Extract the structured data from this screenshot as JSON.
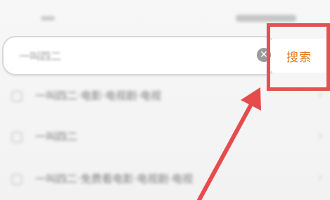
{
  "status_bar": {
    "time": "",
    "icons": [
      "signal-icon",
      "wifi-icon",
      "battery-icon"
    ]
  },
  "search": {
    "value": "一叫四二",
    "placeholder": "",
    "clear_icon": "✕",
    "button_label": "搜索"
  },
  "suggestions": [
    {
      "text": "一叫四二·电影·电视剧·电视",
      "icon": "history-icon"
    },
    {
      "text": "一叫四二",
      "icon": "history-icon"
    },
    {
      "text": "一叫四二·免费看电影·电视剧·电视",
      "icon": "history-icon"
    }
  ],
  "colors": {
    "accent": "#e07a22",
    "highlight": "#e65050",
    "background": "#f6f6f6"
  }
}
